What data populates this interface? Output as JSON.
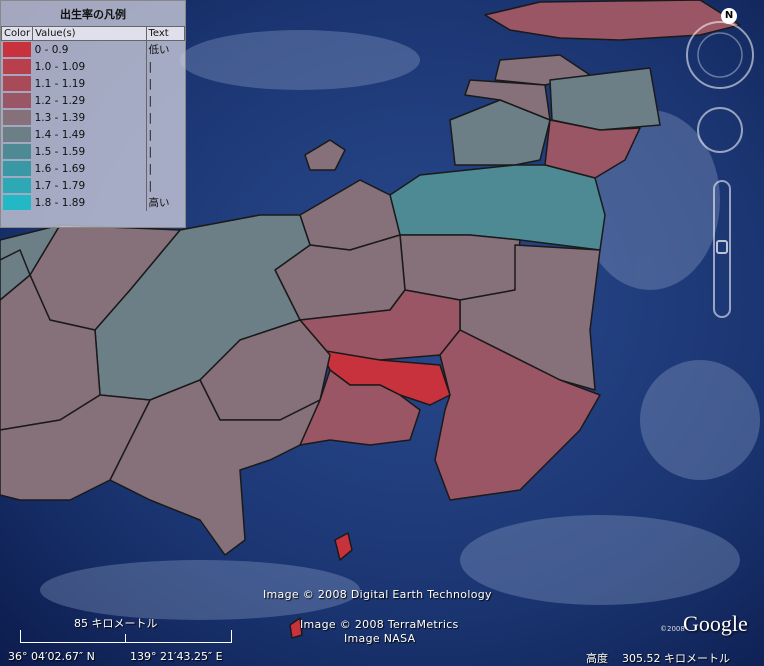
{
  "legend": {
    "title": "出生率の凡例",
    "headers": {
      "color": "Color",
      "values": "Value(s)",
      "text": "Text"
    },
    "rows": [
      {
        "range": "0 - 0.9",
        "color": "#c8323c",
        "text": "低い"
      },
      {
        "range": "1.0 - 1.09",
        "color": "#b8404c",
        "text": "|"
      },
      {
        "range": "1.1 - 1.19",
        "color": "#a94a58",
        "text": "|"
      },
      {
        "range": "1.2 - 1.29",
        "color": "#9a5664",
        "text": "|"
      },
      {
        "range": "1.3 - 1.39",
        "color": "#86707a",
        "text": "|"
      },
      {
        "range": "1.4 - 1.49",
        "color": "#6c7f86",
        "text": "|"
      },
      {
        "range": "1.5 - 1.59",
        "color": "#4e8a94",
        "text": "|"
      },
      {
        "range": "1.6 - 1.69",
        "color": "#3a98a4",
        "text": "|"
      },
      {
        "range": "1.7 - 1.79",
        "color": "#2ea8b4",
        "text": "|"
      },
      {
        "range": "1.8 - 1.89",
        "color": "#22b8c6",
        "text": "高い"
      }
    ]
  },
  "map": {
    "compass_label": "N"
  },
  "credits": {
    "line1": "Image © 2008 Digital Earth Technology",
    "line2": "Image © 2008 TerraMetrics",
    "line3": "Image NASA",
    "google": "Google",
    "google_copy": "©2008"
  },
  "scale": {
    "label": "85 キロメートル"
  },
  "status": {
    "latitude": "36° 04′02.67″ N",
    "longitude": "139° 21′43.25″ E",
    "altitude_label": "高度",
    "altitude_value": "305.52 キロメートル"
  }
}
